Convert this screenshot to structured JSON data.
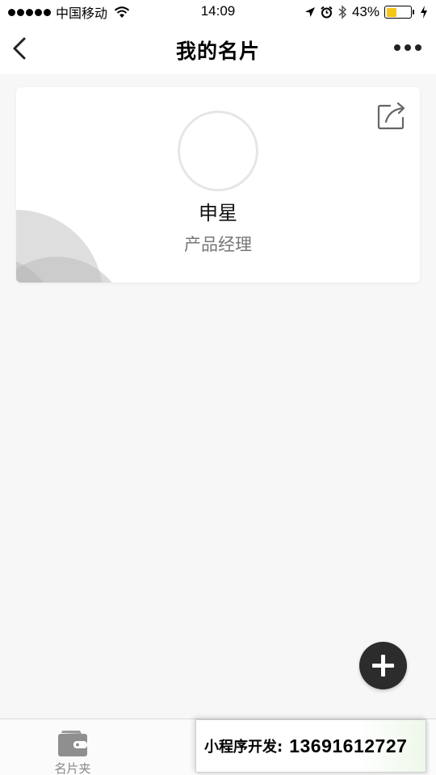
{
  "status_bar": {
    "carrier": "中国移动",
    "time": "14:09",
    "battery_percent": "43%",
    "battery_level": 0.43,
    "battery_color": "#f5c518",
    "icons": [
      "signal-dots-icon",
      "wifi-icon",
      "location-arrow-icon",
      "alarm-icon",
      "bluetooth-icon",
      "battery-icon",
      "charging-icon"
    ]
  },
  "nav": {
    "title": "我的名片",
    "back_icon": "chevron-left-icon",
    "more_icon": "more-dots-icon"
  },
  "card": {
    "name": "申星",
    "title": "产品经理",
    "share_icon": "share-icon"
  },
  "fab": {
    "icon": "plus-icon",
    "color": "#2c2c2c"
  },
  "tab_bar": {
    "tabs": [
      {
        "label": "名片夹",
        "icon": "wallet-icon"
      }
    ]
  },
  "promo": {
    "label": "小程序开发:",
    "phone": "13691612727"
  }
}
